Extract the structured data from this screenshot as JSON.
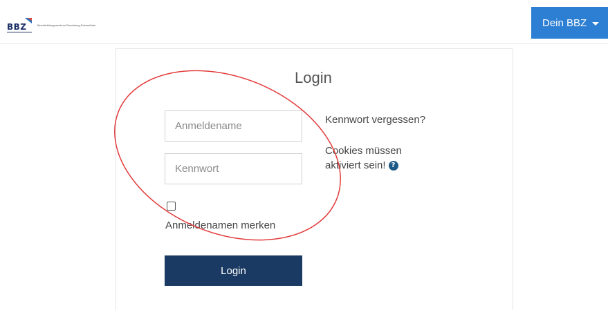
{
  "header": {
    "logo_text": "BBZ",
    "logo_subtext": "Berufsbildungszentrum Rendsburg-Eckernförde",
    "user_menu_label": "Dein BBZ",
    "user_menu_icon": "caret-down-icon",
    "accent_color": "#2d7fd4"
  },
  "login": {
    "title": "Login",
    "username_placeholder": "Anmeldename",
    "username_value": "",
    "password_placeholder": "Kennwort",
    "password_value": "",
    "remember_checked": false,
    "remember_label": "Anmeldenamen merken",
    "button_label": "Login",
    "button_color": "#1b3a63",
    "forgot_password": "Kennwort vergessen?",
    "cookies_notice": "Cookies müssen aktiviert sein!",
    "help_icon": "question-circle-icon"
  },
  "annotation": {
    "shape": "ellipse",
    "color": "#e23b3b"
  }
}
